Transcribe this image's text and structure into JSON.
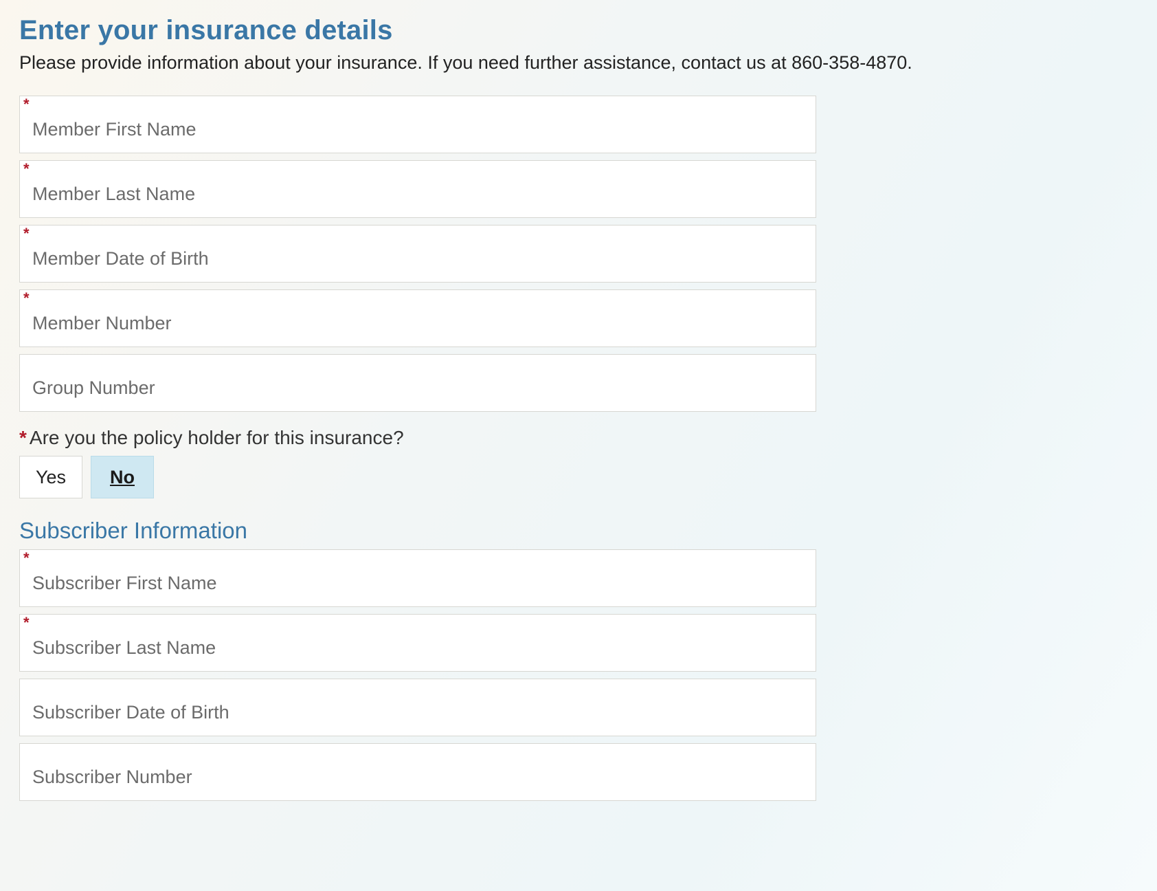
{
  "page": {
    "title": "Enter your insurance details",
    "intro": "Please provide information about your insurance. If you need further assistance, contact us at 860-358-4870."
  },
  "fields": {
    "member_first_name": {
      "placeholder": "Member First Name",
      "value": "",
      "required": true
    },
    "member_last_name": {
      "placeholder": "Member Last Name",
      "value": "",
      "required": true
    },
    "member_dob": {
      "placeholder": "Member Date of Birth",
      "value": "",
      "required": true
    },
    "member_number": {
      "placeholder": "Member Number",
      "value": "",
      "required": true
    },
    "group_number": {
      "placeholder": "Group Number",
      "value": "",
      "required": false
    }
  },
  "policy_holder_question": {
    "label": "Are you the policy holder for this insurance?",
    "required": true,
    "options": {
      "yes": "Yes",
      "no": "No"
    },
    "selected": "no"
  },
  "subscriber": {
    "section_title": "Subscriber Information",
    "first_name": {
      "placeholder": "Subscriber First Name",
      "value": "",
      "required": true
    },
    "last_name": {
      "placeholder": "Subscriber Last Name",
      "value": "",
      "required": true
    },
    "dob": {
      "placeholder": "Subscriber Date of Birth",
      "value": "",
      "required": false
    },
    "number": {
      "placeholder": "Subscriber Number",
      "value": "",
      "required": false
    }
  },
  "required_marker": "*"
}
